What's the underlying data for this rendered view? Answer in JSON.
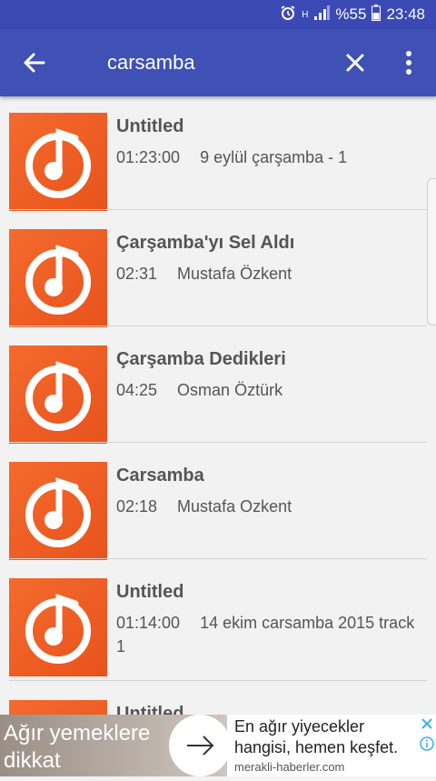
{
  "status_bar": {
    "battery_text": "%55",
    "time": "23:48",
    "network_label": "H"
  },
  "app_bar": {
    "search_query": "carsamba"
  },
  "results": [
    {
      "title": "Untitled",
      "duration": "01:23:00",
      "artist": "9 eylül çarşamba - 1"
    },
    {
      "title": "Çarşamba'yı Sel Aldı",
      "duration": "02:31",
      "artist": "Mustafa Özkent"
    },
    {
      "title": "Çarşamba Dedikleri",
      "duration": "04:25",
      "artist": "Osman Öztürk"
    },
    {
      "title": "Carsamba",
      "duration": "02:18",
      "artist": "Mustafa Ozkent"
    },
    {
      "title": "Untitled",
      "duration": "01:14:00",
      "artist": "14 ekim carsamba 2015 track 1"
    },
    {
      "title": "Untitled",
      "duration": "",
      "artist": ""
    }
  ],
  "ad": {
    "image_text": "Ağır yemeklere dikkat",
    "headline": "En ağır yiyecekler hangisi, hemen keşfet.",
    "url": "merakli-haberler.com"
  },
  "colors": {
    "app_bar": "#3f51b5",
    "status_bar": "#3b49b5",
    "thumb_orange": "#f05a24"
  },
  "icons": {
    "back": "arrow-left-icon",
    "clear": "close-icon",
    "more": "more-vert-icon",
    "track": "music-note-icon"
  }
}
